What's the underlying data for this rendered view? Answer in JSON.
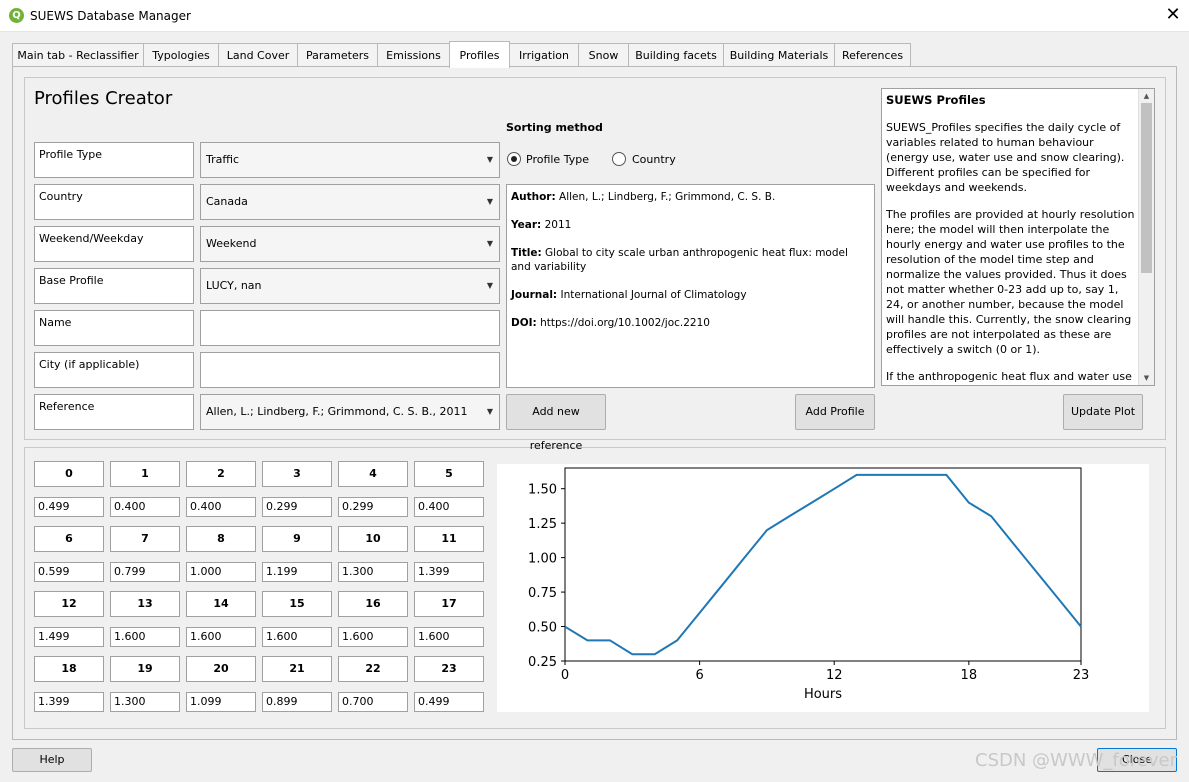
{
  "window": {
    "title": "SUEWS Database Manager",
    "close_glyph": "✕",
    "icon_letter": "Q",
    "icon_color": "#6fb33b"
  },
  "tabs": [
    "Main tab - Reclassifier",
    "Typologies",
    "Land Cover",
    "Parameters",
    "Emissions",
    "Profiles",
    "Irrigation",
    "Snow",
    "Building facets",
    "Building Materials",
    "References"
  ],
  "active_tab": "Profiles",
  "creator": {
    "title": "Profiles Creator",
    "fields": [
      {
        "label": "Profile Type",
        "value": "Traffic",
        "kind": "combo"
      },
      {
        "label": "Country",
        "value": "Canada",
        "kind": "combo"
      },
      {
        "label": "Weekend/Weekday",
        "value": "Weekend",
        "kind": "combo"
      },
      {
        "label": "Base Profile",
        "value": "LUCY, nan",
        "kind": "combo"
      },
      {
        "label": "Name",
        "value": "",
        "kind": "text"
      },
      {
        "label": "City (if applicable)",
        "value": "",
        "kind": "text"
      },
      {
        "label": "Reference",
        "value": "Allen, L.; Lindberg, F.; Grimmond, C. S. B., 2011",
        "kind": "combo"
      }
    ],
    "sorting": {
      "title": "Sorting method",
      "options": [
        "Profile Type",
        "Country"
      ],
      "selected": "Profile Type"
    },
    "reference_info": {
      "author_label": "Author:",
      "author": "Allen, L.; Lindberg, F.; Grimmond, C. S. B.",
      "year_label": "Year:",
      "year": "2011",
      "title_label": "Title:",
      "title": "Global to city scale urban anthropogenic heat flux: model and variability",
      "journal_label": "Journal:",
      "journal": "International Journal of Climatology",
      "doi_label": "DOI:",
      "doi": "https://doi.org/10.1002/joc.2210"
    },
    "buttons": {
      "add_reference": "Add new reference",
      "add_profile": "Add Profile",
      "update_plot": "Update Plot"
    }
  },
  "help_panel": {
    "title": "SUEWS Profiles",
    "paragraphs": [
      "SUEWS_Profiles specifies the daily cycle of variables related to human behaviour (energy use, water use and snow clearing). Different profiles can be specified for weekdays and weekends.",
      "The profiles are provided at hourly resolution here; the model will then interpolate the hourly energy and water use profiles to the resolution of the model time step and normalize the values provided. Thus it does not matter whether 0-23 add up to, say 1, 24, or another number, because the model will handle this. Currently, the snow clearing profiles are not interpolated as these are effectively a switch (0 or 1).",
      "If the anthropogenic heat flux and water use are specified in the input for profile the"
    ]
  },
  "hours": {
    "labels": [
      "0",
      "1",
      "2",
      "3",
      "4",
      "5",
      "6",
      "7",
      "8",
      "9",
      "10",
      "11",
      "12",
      "13",
      "14",
      "15",
      "16",
      "17",
      "18",
      "19",
      "20",
      "21",
      "22",
      "23"
    ],
    "values": [
      "0.499",
      "0.400",
      "0.400",
      "0.299",
      "0.299",
      "0.400",
      "0.599",
      "0.799",
      "1.000",
      "1.199",
      "1.300",
      "1.399",
      "1.499",
      "1.600",
      "1.600",
      "1.600",
      "1.600",
      "1.600",
      "1.399",
      "1.300",
      "1.099",
      "0.899",
      "0.700",
      "0.499"
    ]
  },
  "chart_data": {
    "type": "line",
    "x": [
      0,
      1,
      2,
      3,
      4,
      5,
      6,
      7,
      8,
      9,
      10,
      11,
      12,
      13,
      14,
      15,
      16,
      17,
      18,
      19,
      20,
      21,
      22,
      23
    ],
    "series": [
      {
        "values": [
          0.499,
          0.4,
          0.4,
          0.299,
          0.299,
          0.4,
          0.599,
          0.799,
          1.0,
          1.199,
          1.3,
          1.399,
          1.499,
          1.6,
          1.6,
          1.6,
          1.6,
          1.6,
          1.399,
          1.3,
          1.099,
          0.899,
          0.7,
          0.499
        ],
        "color": "#1f77b4"
      }
    ],
    "xlabel": "Hours",
    "ylabel": "",
    "xlim": [
      0,
      23
    ],
    "ylim": [
      0.25,
      1.65
    ],
    "xticks": [
      0,
      6,
      12,
      18,
      23
    ],
    "yticks": [
      "0.25",
      "0.50",
      "0.75",
      "1.00",
      "1.25",
      "1.50"
    ],
    "grid": false
  },
  "footer": {
    "help": "Help",
    "close": "Close"
  },
  "watermark": "CSDN @WWW_forever"
}
